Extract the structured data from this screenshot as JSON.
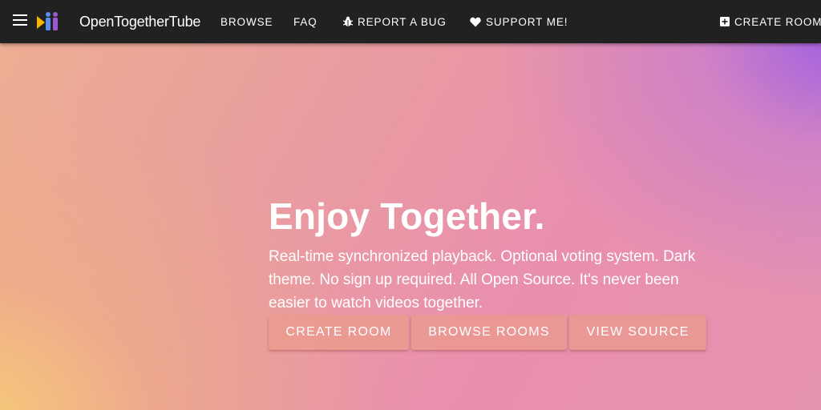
{
  "appbar": {
    "brand": "OpenTogetherTube",
    "nav": {
      "browse": "BROWSE",
      "faq": "FAQ",
      "report_bug": "REPORT A BUG",
      "support": "SUPPORT ME!",
      "create_room": "CREATE ROOM"
    },
    "icons": {
      "menu": "menu-icon",
      "logo": "opentogethertube-logo",
      "bug": "bug-icon",
      "heart": "heart-icon",
      "plus": "plus-box-icon"
    }
  },
  "hero": {
    "title": "Enjoy Together.",
    "text": "Real-time synchronized playback. Optional voting system. Dark theme. No sign up required. All Open Source. It's never been easier to watch videos together.",
    "buttons": {
      "create_room": "CREATE ROOM",
      "browse_rooms": "BROWSE ROOMS",
      "view_source": "VIEW SOURCE"
    }
  },
  "colors": {
    "appbar": "#212121",
    "text": "#ffffff",
    "logo_yellow": "#f7b500",
    "logo_blue": "#5a8ef0",
    "logo_purple": "#9b59d0"
  }
}
